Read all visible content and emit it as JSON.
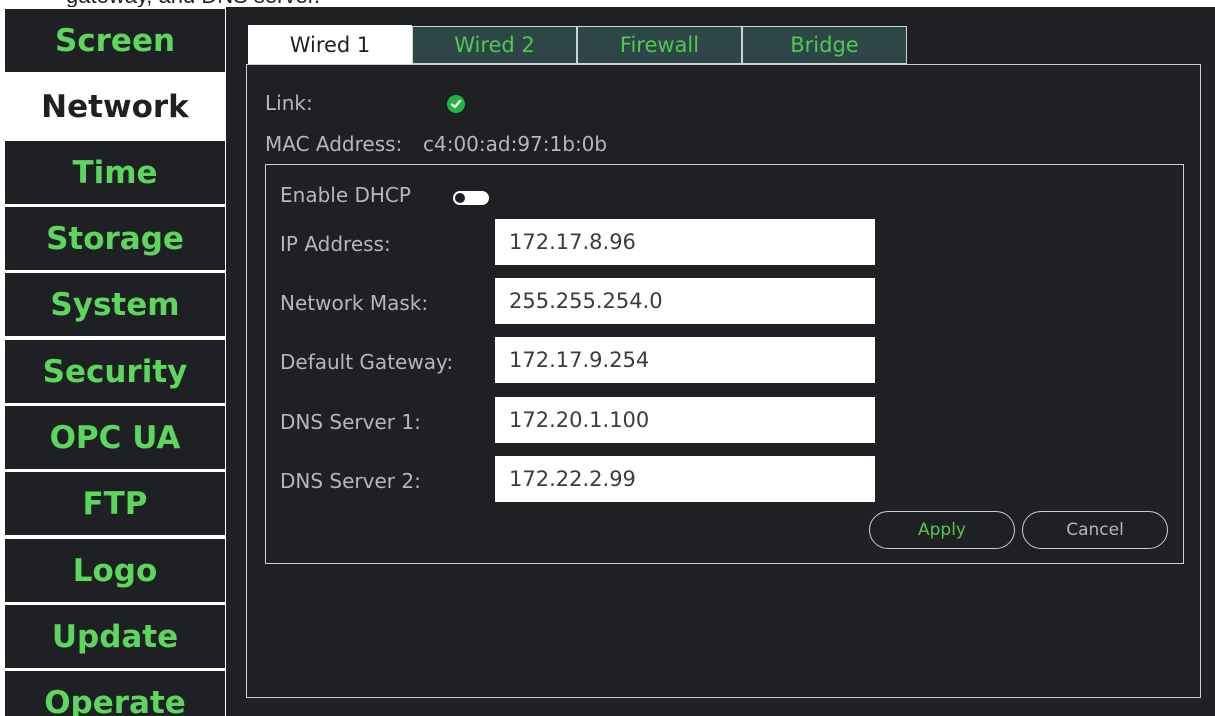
{
  "caption": "gateway, and DNS server.",
  "sidebar": {
    "items": [
      {
        "label": "Screen",
        "active": false
      },
      {
        "label": "Network",
        "active": true
      },
      {
        "label": "Time",
        "active": false
      },
      {
        "label": "Storage",
        "active": false
      },
      {
        "label": "System",
        "active": false
      },
      {
        "label": "Security",
        "active": false
      },
      {
        "label": "OPC UA",
        "active": false
      },
      {
        "label": "FTP",
        "active": false
      },
      {
        "label": "Logo",
        "active": false
      },
      {
        "label": "Update",
        "active": false
      },
      {
        "label": "Operate",
        "active": false
      }
    ]
  },
  "tabs": [
    {
      "label": "Wired 1",
      "active": true
    },
    {
      "label": "Wired 2",
      "active": false
    },
    {
      "label": "Firewall",
      "active": false
    },
    {
      "label": "Bridge",
      "active": false
    }
  ],
  "status": {
    "link_label": "Link:",
    "link_icon": "check-circle-icon",
    "mac_label": "MAC Address:",
    "mac_value": "c4:00:ad:97:1b:0b"
  },
  "form": {
    "dhcp_label": "Enable DHCP",
    "dhcp_enabled": false,
    "ip_label": "IP Address:",
    "ip_value": "172.17.8.96",
    "mask_label": "Network Mask:",
    "mask_value": "255.255.254.0",
    "gateway_label": "Default Gateway:",
    "gateway_value": "172.17.9.254",
    "dns1_label": "DNS Server 1:",
    "dns1_value": "172.20.1.100",
    "dns2_label": "DNS Server 2:",
    "dns2_value": "172.22.2.99",
    "apply_label": "Apply",
    "cancel_label": "Cancel"
  },
  "colors": {
    "background": "#1f2023",
    "accent_green": "#5cd65c",
    "link_ok": "#22b543",
    "inactive_tab": "#2e4648"
  }
}
